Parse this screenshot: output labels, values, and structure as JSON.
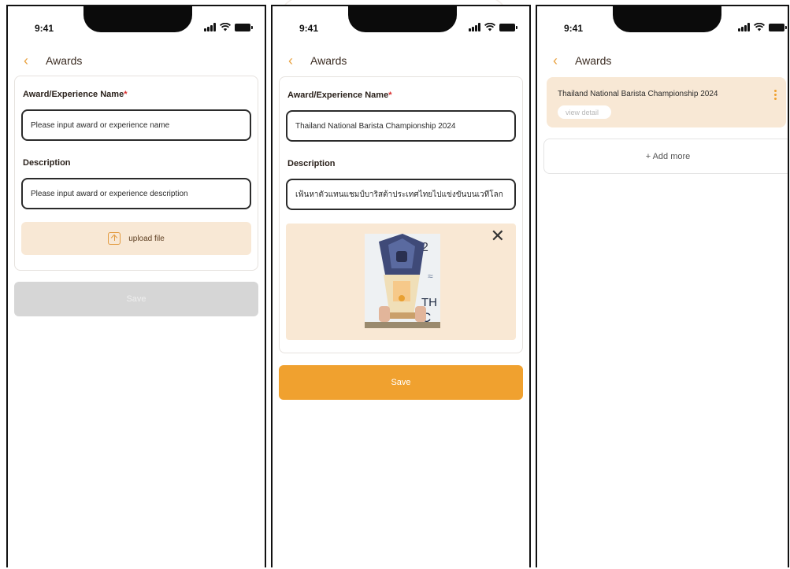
{
  "status_bar": {
    "time": "9:41"
  },
  "screens": [
    {
      "header_title": "Awards",
      "form": {
        "name_label": "Award/Experience Name",
        "required_mark": "*",
        "name_placeholder": "Please input award or experience name",
        "description_label": "Description",
        "description_placeholder": "Please input award or experience description",
        "upload_label": "upload file"
      },
      "save_label": "Save",
      "save_state": "disabled"
    },
    {
      "header_title": "Awards",
      "form": {
        "name_label": "Award/Experience Name",
        "required_mark": "*",
        "name_value": "Thailand National Barista Championship 2024",
        "description_label": "Description",
        "description_value": "เฟ้นหาตัวแทนแชมป์บาริสต้าประเทศไทยไปแข่งขันบนเวทีโลก"
      },
      "save_label": "Save",
      "save_state": "active"
    },
    {
      "header_title": "Awards",
      "award_item": {
        "title": "Thailand National Barista Championship 2024",
        "view_detail_label": "view detail"
      },
      "add_more_label": "+ Add more"
    }
  ],
  "colors": {
    "accent": "#f0a12f",
    "upload_bg": "#f8e8d5",
    "disabled": "#d6d6d6",
    "required": "#d92b2b"
  },
  "icons": [
    "signal-icon",
    "wifi-icon",
    "battery-icon",
    "back-chevron-icon",
    "upload-icon",
    "close-icon",
    "more-vertical-icon"
  ]
}
